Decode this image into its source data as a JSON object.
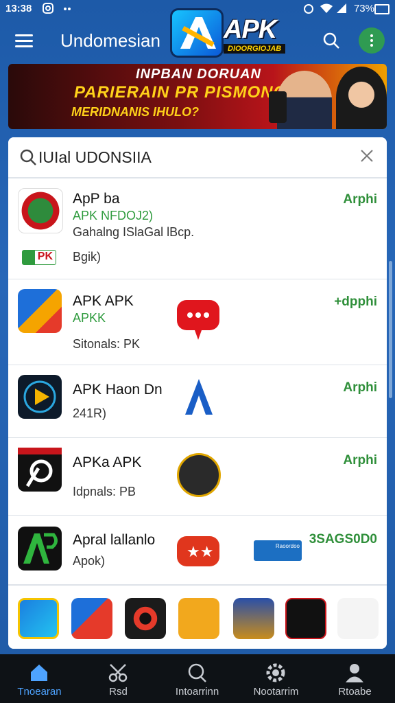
{
  "status_bar": {
    "time": "13:38",
    "battery": "73%"
  },
  "app_bar": {
    "title": "Undomesian",
    "logo_text": "APK",
    "logo_sub": "DIOORGIOJAB"
  },
  "banner": {
    "line1": "INPBAN DORUAN",
    "line2": "PARIERAIN PR PISMONO",
    "line3": "MERIDNANIS IHULO?"
  },
  "search": {
    "query": "IUIal UDONSIIA"
  },
  "apps": [
    {
      "name": "ApP ba",
      "tag": "APK  NFDOJ2)",
      "meta": "Gahalng ISlaGal lBcp.",
      "size": "Bgik)",
      "badge": "PK",
      "action": "Arphi"
    },
    {
      "name": "APK APK",
      "tag": "APKK",
      "meta": "Sitonals: PK",
      "action": "+dpphi"
    },
    {
      "name": "APK Haon Dn",
      "meta": "241R)",
      "action": "Arphi"
    },
    {
      "name": "APKa APK",
      "meta": "Idpnals: PB",
      "action": "Arphi"
    },
    {
      "name": "Apral lallanlo",
      "meta": "Apok)",
      "action": "3SAGS0D0",
      "badge": "Raoordoo"
    }
  ],
  "nav": [
    {
      "label": "Tnoearan",
      "active": true
    },
    {
      "label": "Rsd"
    },
    {
      "label": "Intoarrinn"
    },
    {
      "label": "Nootarrim"
    },
    {
      "label": "Rtoabe"
    }
  ],
  "colors": {
    "accent": "#2f9b3e",
    "appbar": "#1d5aa8",
    "nav_bg": "#0e1216",
    "nav_active": "#4ea3ff"
  }
}
